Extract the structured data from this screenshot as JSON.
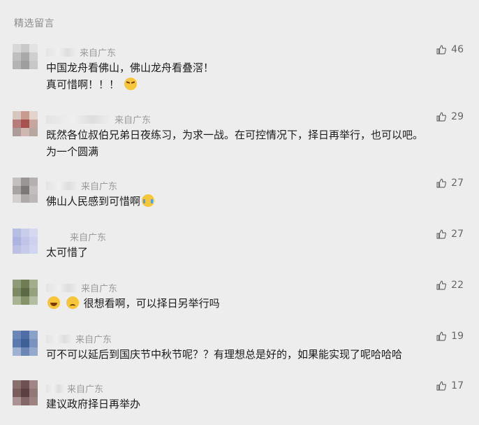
{
  "section_title": "精选留言",
  "comments": [
    {
      "location": "来自广东",
      "likes": "46",
      "lines": [
        "中国龙舟看佛山，佛山龙舟看叠滘！",
        "真可惜啊！！！"
      ],
      "avatar_colors": [
        "#d8d8d8",
        "#c9c9c9",
        "#e2e2e2",
        "#bfbfbf",
        "#a9a9a9",
        "#cfcfcf",
        "#b4b4b4",
        "#9e9e9e",
        "#c7c7c7"
      ]
    },
    {
      "location": "来自广东",
      "likes": "29",
      "lines": [
        "既然各位叔伯兄弟日夜练习，为求一战。在可控情况下，择日再举行，也可以吧。",
        "为一个圆满"
      ],
      "avatar_colors": [
        "#d7c7be",
        "#c79b8f",
        "#e4d3cc",
        "#b77d7a",
        "#a7524f",
        "#c8a6a0",
        "#ad9c99",
        "#cfb8b0",
        "#b6a8a0"
      ]
    },
    {
      "location": "来自广东",
      "likes": "27",
      "lines": [
        "佛山人民感到可惜啊"
      ],
      "avatar_colors": [
        "#c5c0c0",
        "#9a9595",
        "#b5b0b0",
        "#a7a3a3",
        "#7d7878",
        "#c2bebe",
        "#d3cfcf",
        "#aeaaaa",
        "#bbb7b7"
      ]
    },
    {
      "location": "来自广东",
      "likes": "27",
      "lines": [
        "太可惜了"
      ],
      "avatar_colors": [
        "#b8bde3",
        "#c9cdec",
        "#d6d8f0",
        "#aeb4e0",
        "#c0c4e8",
        "#cfd2ee",
        "#bcc0e5",
        "#c6cae9",
        "#d2d5ef"
      ]
    },
    {
      "location": "来自广东",
      "likes": "22",
      "lines": [
        "很想看啊，可以择日另举行吗"
      ],
      "avatar_colors": [
        "#8e9b78",
        "#6f7d55",
        "#a2ae8e",
        "#7b8a63",
        "#5b6a45",
        "#94a27d",
        "#a9b495",
        "#86946c",
        "#b3bd9f"
      ]
    },
    {
      "location": "来自广东",
      "likes": "19",
      "lines": [
        "可不可以延后到国庆节中秋节呢？？有理想总是好的，如果能实现了呢哈哈哈"
      ],
      "avatar_colors": [
        "#6b87b8",
        "#4f6ea6",
        "#8aa1c8",
        "#5d7aae",
        "#3f5f97",
        "#7b93bf",
        "#a0b2d2",
        "#6c86b5",
        "#95a9cd"
      ]
    },
    {
      "location": "来自广东",
      "likes": "17",
      "lines": [
        "建议政府择日再举办"
      ],
      "avatar_colors": [
        "#8a6f6f",
        "#6e5252",
        "#a08686",
        "#7a5e5e",
        "#5a4040",
        "#937878",
        "#ab9393",
        "#846868",
        "#9d8282"
      ]
    }
  ]
}
